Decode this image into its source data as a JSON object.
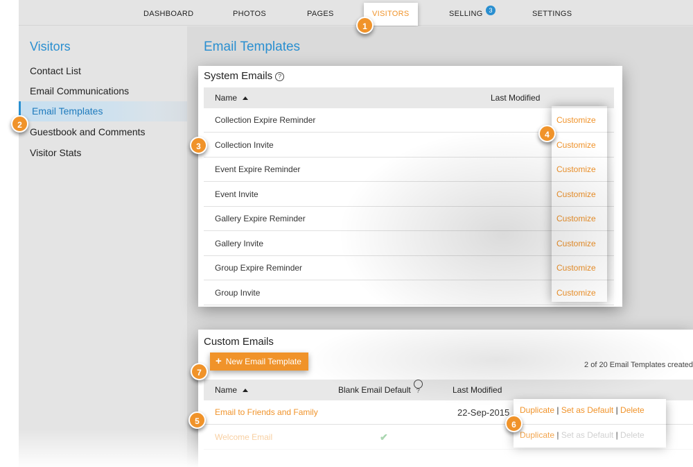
{
  "nav": {
    "items": [
      {
        "label": "DASHBOARD"
      },
      {
        "label": "PHOTOS"
      },
      {
        "label": "PAGES"
      },
      {
        "label": "VISITORS"
      },
      {
        "label": "SELLING",
        "badge": "3"
      },
      {
        "label": "SETTINGS"
      }
    ],
    "active": "VISITORS"
  },
  "sidebar": {
    "title": "Visitors",
    "items": [
      {
        "label": "Contact List"
      },
      {
        "label": "Email Communications"
      },
      {
        "label": "Email Templates"
      },
      {
        "label": "Guestbook and Comments"
      },
      {
        "label": "Visitor Stats"
      }
    ]
  },
  "main": {
    "title": "Email Templates",
    "system": {
      "title": "System Emails",
      "help": "?",
      "columns": {
        "name": "Name",
        "modified": "Last Modified"
      },
      "action": "Customize",
      "rows": [
        {
          "name": "Collection Expire Reminder"
        },
        {
          "name": "Collection Invite"
        },
        {
          "name": "Event Expire Reminder"
        },
        {
          "name": "Event Invite"
        },
        {
          "name": "Gallery Expire Reminder"
        },
        {
          "name": "Gallery Invite"
        },
        {
          "name": "Group Expire Reminder"
        },
        {
          "name": "Group Invite"
        }
      ]
    },
    "custom": {
      "title": "Custom Emails",
      "new_button": "New Email Template",
      "count_text": "2 of 20 Email Templates created",
      "columns": {
        "name": "Name",
        "blank_default": "Blank Email Default",
        "help": "?",
        "modified": "Last Modified"
      },
      "rows": [
        {
          "name": "Email to Friends and Family",
          "modified": "22-Sep-2015",
          "is_default": false
        },
        {
          "name": "Welcome Email",
          "modified": "",
          "is_default": true
        }
      ],
      "actions": {
        "duplicate": "Duplicate",
        "sep": "|",
        "set_default": "Set as Default",
        "delete": "Delete"
      }
    }
  },
  "callouts": [
    "1",
    "2",
    "3",
    "4",
    "5",
    "6",
    "7"
  ],
  "colors": {
    "accent_orange": "#f0932a",
    "accent_blue": "#2a8fd0",
    "check_green": "#3aa24a"
  }
}
